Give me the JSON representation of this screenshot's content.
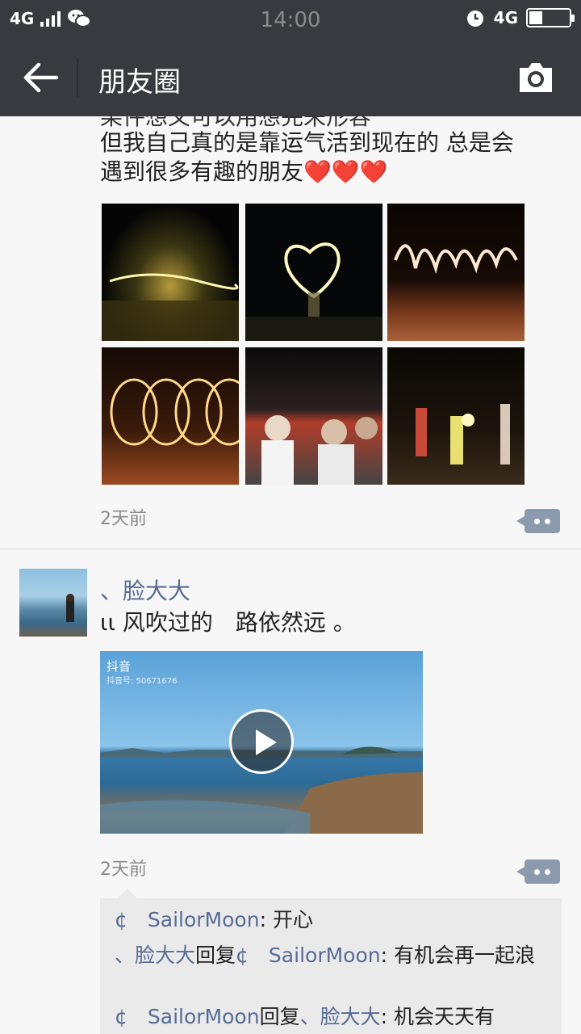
{
  "status_bar": {
    "left_network": "4G",
    "time": "14:00",
    "right_network": "4G"
  },
  "app_bar": {
    "title": "朋友圈"
  },
  "post1": {
    "text_partial_line": "某件想义可以用想完来形容",
    "text_line1": "但我自己真的是靠运气活到现在的 总是会",
    "text_line2": "遇到很多有趣的朋友❤️❤️❤️",
    "time": "2天前",
    "image_count": 6
  },
  "post2": {
    "username": "、脸大大",
    "text": "ιι 风吹过的　路依然远 。",
    "video_watermark": "抖音",
    "video_id": "抖音号: 50671676",
    "time": "2天前",
    "comments": [
      {
        "from": "¢　SailorMoon",
        "sep": ": ",
        "text": "开心"
      },
      {
        "from": "、脸大大",
        "mid": "回复",
        "to": "¢　SailorMoon",
        "sep": ": ",
        "text": "有机会再一起浪"
      },
      {
        "from": "¢　SailorMoon",
        "mid": "回复",
        "to": "、脸大大",
        "sep": ": ",
        "text": "机会天天有"
      }
    ]
  },
  "colors": {
    "bar_bg": "#393a3f",
    "link": "#576b95",
    "feed_bg": "#f7f7f7"
  }
}
